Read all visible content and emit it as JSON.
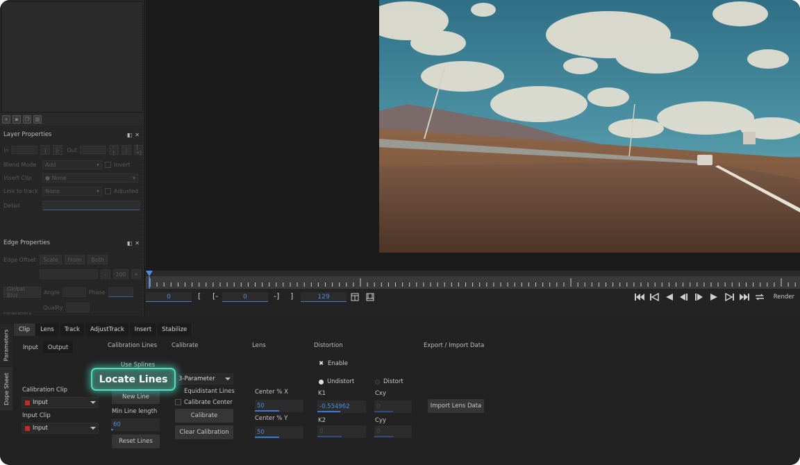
{
  "left_panel": {
    "layer_properties": {
      "title": "Layer Properties",
      "in_label": "In",
      "out_label": "Out",
      "blend_mode_label": "Blend Mode",
      "blend_mode_value": "Add",
      "invert_label": "Invert",
      "insert_clip_label": "Insert Clip",
      "insert_clip_value": "None",
      "link_to_track_label": "Link to track",
      "link_to_track_value": "None",
      "adjusted_label": "Adjusted",
      "detail_label": "Detail"
    },
    "edge_properties": {
      "title": "Edge Properties",
      "edge_offset_label": "Edge Offset",
      "scale_btn": "Scale",
      "from_btn": "From",
      "both_btn": "Both",
      "minus_btn": "-",
      "value_btn": "100",
      "plus_btn": "+",
      "global_btn": "Global Blur",
      "angle_label": "Angle",
      "phase_label": "Phase",
      "quality_label": "Quality"
    },
    "parameters_partial": "Parameters"
  },
  "transport": {
    "current_frame": "0",
    "in_bracket": "[",
    "in_mark": "[-",
    "in_value": "0",
    "out_mark": "-]",
    "out_bracket": "]",
    "out_value": "129",
    "render_label": "Render"
  },
  "side_tabs": [
    "Parameters",
    "Dope Sheet"
  ],
  "tabs": [
    "Clip",
    "Lens",
    "Track",
    "AdjustTrack",
    "Insert",
    "Stabilize"
  ],
  "subtabs": [
    "Input",
    "Output"
  ],
  "sections": {
    "calibration_lines": "Calibration Lines",
    "calibrate": "Calibrate",
    "lens": "Lens",
    "distortion": "Distortion",
    "export_import": "Export / Import Data"
  },
  "clip": {
    "calibration_clip_label": "Calibration Clip",
    "calibration_clip_value": "Input",
    "input_clip_label": "Input Clip",
    "input_clip_value": "Input"
  },
  "calibration_lines": {
    "use_splines": "Use Splines",
    "locate_lines": "Locate Lines",
    "new_line": "New Line",
    "min_line_length_label": "Min Line length",
    "min_line_length_value": "60",
    "reset_lines": "Reset Lines"
  },
  "calibrate": {
    "model_value": "3-Parameter",
    "equidistant_lines": "Equidistant Lines",
    "calibrate_center": "Calibrate Center",
    "calibrate_btn": "Calibrate",
    "clear_btn": "Clear Calibration"
  },
  "lens": {
    "center_x_label": "Center % X",
    "center_x_value": "50",
    "center_y_label": "Center % Y",
    "center_y_value": "50"
  },
  "distortion": {
    "enable_label": "Enable",
    "undistort_label": "Undistort",
    "distort_label": "Distort",
    "k1_label": "K1",
    "k1_value": "-0.554962",
    "k2_label": "K2",
    "k2_value": "0",
    "cxy_label": "Cxy",
    "cxy_value": "0",
    "cyy_label": "Cyy",
    "cyy_value": "0"
  },
  "export": {
    "import_lens_btn": "Import Lens Data"
  },
  "colors": {
    "accent_blue": "#4a90e2",
    "highlight_teal": "#4fe0c3",
    "clip_red": "#c42b2b"
  }
}
